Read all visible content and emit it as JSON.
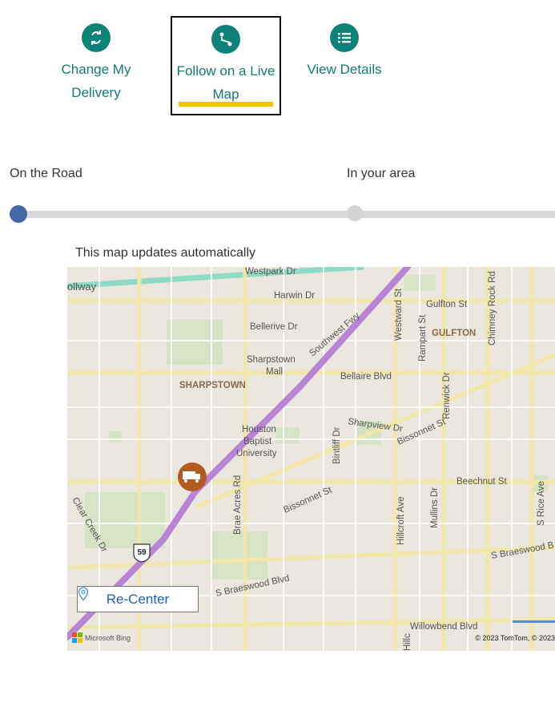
{
  "tabs": [
    {
      "label": "Change My Delivery",
      "icon": "refresh-icon",
      "active": false
    },
    {
      "label": "Follow on a Live Map",
      "icon": "route-icon",
      "active": true
    },
    {
      "label": "View Details",
      "icon": "list-icon",
      "active": false
    }
  ],
  "progress": {
    "steps": [
      {
        "label": "On the Road",
        "done": true
      },
      {
        "label": "In your area",
        "done": false
      }
    ]
  },
  "map": {
    "note": "This map updates automatically",
    "recenter_label": "Re-Center",
    "provider": "Microsoft Bing",
    "copyright": "© 2023 TomTom, © 2023",
    "highway_shield": "59",
    "vehicle_icon": "truck-icon",
    "labels": {
      "westpark": "Westpark Dr",
      "tollway": "ollway",
      "harwin": "Harwin Dr",
      "gulfton_st": "Gulfton St",
      "gulfton": "GULFTON",
      "bellerive": "Bellerive Dr",
      "sharpstown_mall_1": "Sharpstown",
      "sharpstown_mall_2": "Mall",
      "bellaire": "Bellaire Blvd",
      "sharpstown": "SHARPSTOWN",
      "houston_1": "Houston",
      "houston_2": "Baptist",
      "houston_3": "University",
      "sharpview": "Sharpview Dr",
      "bissonnet_ne": "Bissonnet St",
      "bissonnet_sw": "Bissonnet St",
      "beechnut": "Beechnut St",
      "clear_creek": "Clear Creek Dr",
      "s_braeswood_w": "S Braeswood Blvd",
      "s_braeswood_e": "S Braeswood B",
      "willowbend": "Willowbend Blvd",
      "swfwy": "Southwest Fwy",
      "westward": "Westward St",
      "rampart": "Rampart St",
      "chimney": "Chimney Rock Rd",
      "renwick": "Renwick Dr",
      "bintliff": "Bintliff Dr",
      "brae_acres": "Brae Acres Rd",
      "hillcroft": "Hillcroft Ave",
      "mullins": "Mullins Dr",
      "s_rice": "S Rice Ave",
      "hillc": "Hillc"
    }
  },
  "colors": {
    "accent": "#0d8278",
    "tab_text": "#127a77",
    "active_underline": "#f5c400",
    "progress_done": "#4467a7",
    "progress_track": "#d9d9d9",
    "recenter_text": "#1d5fbf",
    "route": "#b884d6",
    "vehicle": "#b35a21"
  }
}
